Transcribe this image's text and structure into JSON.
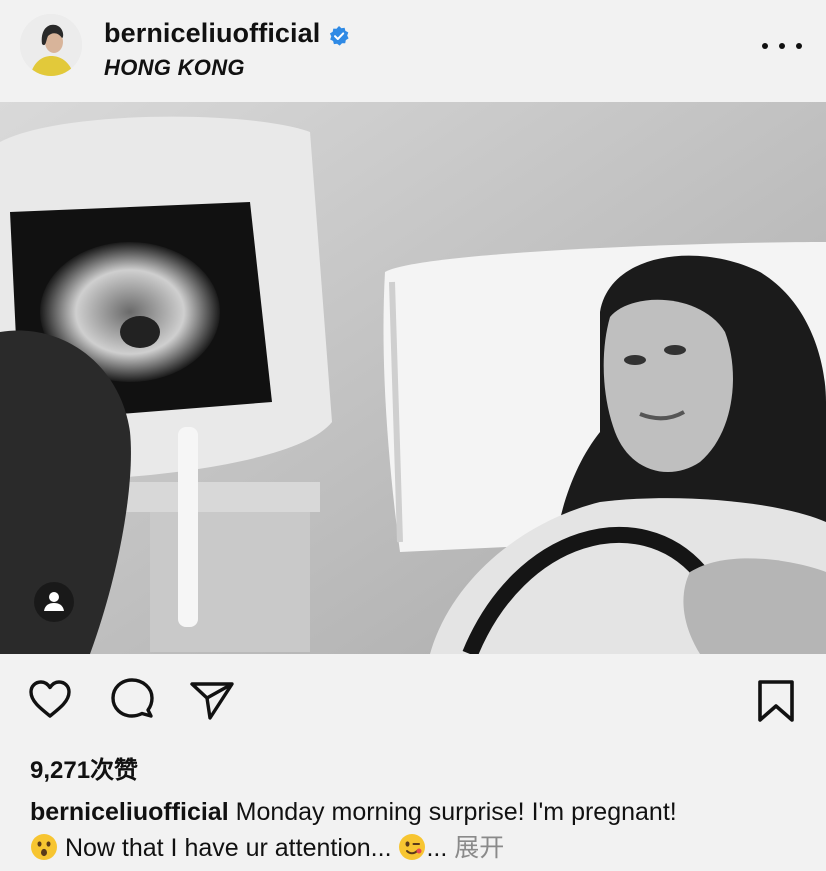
{
  "post": {
    "username": "bernice​liuofficial",
    "location": "HONG KONG"
  },
  "photo": {
    "alt_icon": "user-tag-icon"
  },
  "actions": {
    "like_icon": "heart-icon",
    "comment_icon": "comment-icon",
    "share_icon": "send-icon",
    "save_icon": "bookmark-icon"
  },
  "likes": {
    "count": "9,271",
    "suffix": "次赞"
  },
  "caption": {
    "username": "berniceliuofficial",
    "text_line1": " Monday morning surprise! I'm pregnant!",
    "text_line2": " Now that I have ur attention... ",
    "ellipsis": "...",
    "more_label": " 展开"
  },
  "colors": {
    "background": "#f2f2f2",
    "verified_blue": "#2f8ae5",
    "muted_text": "#8a8a8a"
  }
}
